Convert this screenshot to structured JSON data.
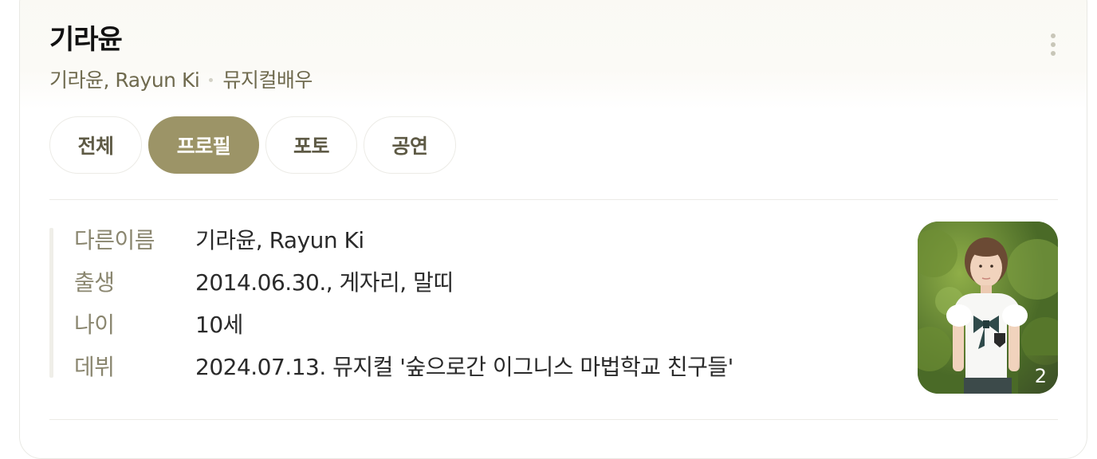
{
  "header": {
    "title": "기라윤",
    "names": "기라윤, Rayun Ki",
    "occupation": "뮤지컬배우"
  },
  "tabs": [
    {
      "label": "전체",
      "active": false
    },
    {
      "label": "프로필",
      "active": true
    },
    {
      "label": "포토",
      "active": false
    },
    {
      "label": "공연",
      "active": false
    }
  ],
  "profile": {
    "rows": [
      {
        "label": "다른이름",
        "value": "기라윤, Rayun Ki"
      },
      {
        "label": "출생",
        "value": "2014.06.30., 게자리, 말띠"
      },
      {
        "label": "나이",
        "value": "10세"
      },
      {
        "label": "데뷔",
        "value": "2024.07.13. 뮤지컬 '숲으로간 이그니스 마법학교 친구들'"
      }
    ],
    "photo_count": "2"
  },
  "colors": {
    "accent": "#9c9467",
    "subtitle": "#6f6a4e",
    "label": "#8a866f"
  }
}
